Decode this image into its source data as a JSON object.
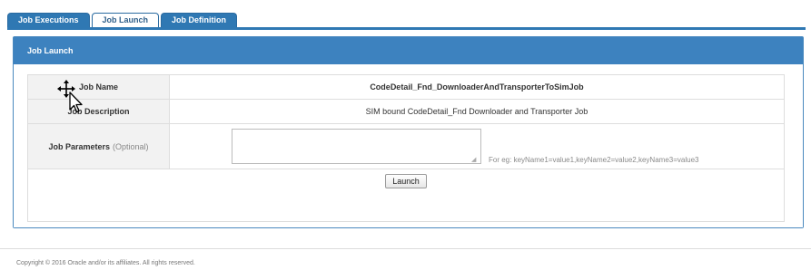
{
  "tabs": [
    {
      "label": "Job Executions",
      "active": false
    },
    {
      "label": "Job Launch",
      "active": true
    },
    {
      "label": "Job Definition",
      "active": false
    }
  ],
  "panel": {
    "title": "Job Launch",
    "rows": {
      "job_name": {
        "label": "Job Name",
        "value": "CodeDetail_Fnd_DownloaderAndTransporterToSimJob"
      },
      "job_description": {
        "label": "Job Description",
        "value": "SIM bound CodeDetail_Fnd Downloader and Transporter Job"
      },
      "job_parameters": {
        "label": "Job Parameters",
        "optional_text": "(Optional)",
        "value": "",
        "hint": "For eg: keyName1=value1,keyName2=value2,keyName3=value3"
      }
    },
    "launch_button": "Launch"
  },
  "footer": {
    "copyright": "Copyright © 2016 Oracle and/or its affiliates. All rights reserved."
  },
  "colors": {
    "accent": "#3d82bf",
    "tab_blue": "#2f78b3",
    "label_bg": "#f2f2f2"
  },
  "icons": {
    "cursor": "move-cursor-icon"
  }
}
